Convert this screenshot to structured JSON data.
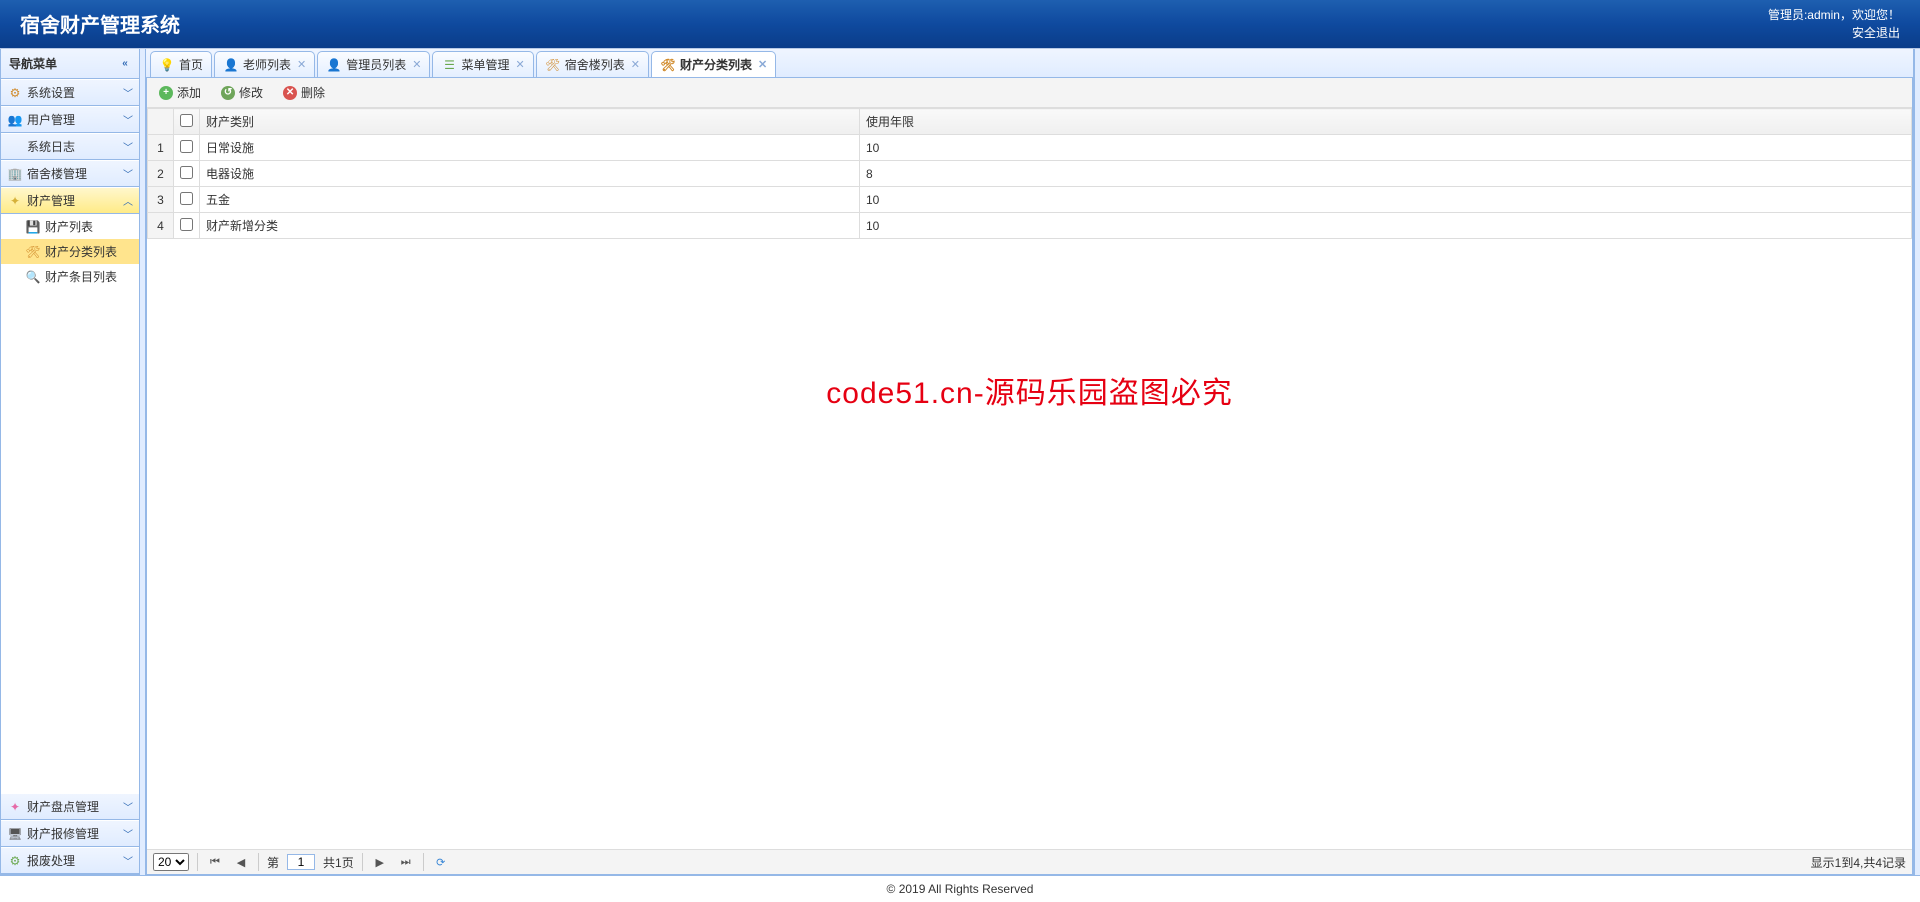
{
  "header": {
    "title": "宿舍财产管理系统",
    "admin_prefix": "管理员:",
    "admin_name": "admin",
    "welcome_suffix": "，欢迎您！",
    "logout": "安全退出"
  },
  "sidebar": {
    "title": "导航菜单",
    "panels": [
      {
        "label": "系统设置",
        "icon": "⚙",
        "color": "#d08a2a"
      },
      {
        "label": "用户管理",
        "icon": "👥",
        "color": "#3a87d6"
      },
      {
        "label": "系统日志",
        "icon": "",
        "color": "#555"
      },
      {
        "label": "宿舍楼管理",
        "icon": "🏢",
        "color": "#4a90d9"
      },
      {
        "label": "财产管理",
        "icon": "✦",
        "color": "#d6b13a",
        "active": true,
        "children": [
          {
            "label": "财产列表",
            "icon": "💾",
            "color": "#5a9bd4"
          },
          {
            "label": "财产分类列表",
            "icon": "🛠",
            "color": "#d08a2a",
            "active": true
          },
          {
            "label": "财产条目列表",
            "icon": "🔍",
            "color": "#5a9bd4"
          }
        ]
      },
      {
        "label": "财产盘点管理",
        "icon": "✦",
        "color": "#e66aa8"
      },
      {
        "label": "财产报修管理",
        "icon": "🖥",
        "color": "#555"
      },
      {
        "label": "报废处理",
        "icon": "⚙",
        "color": "#6aa84f"
      }
    ]
  },
  "tabs": [
    {
      "label": "首页",
      "icon": "💡",
      "color": "#f5c518",
      "closable": false
    },
    {
      "label": "老师列表",
      "icon": "👤",
      "color": "#5a9bd4",
      "closable": true
    },
    {
      "label": "管理员列表",
      "icon": "👤",
      "color": "#7e9e4a",
      "closable": true
    },
    {
      "label": "菜单管理",
      "icon": "☰",
      "color": "#6aa84f",
      "closable": true
    },
    {
      "label": "宿舍楼列表",
      "icon": "🛠",
      "color": "#d08a2a",
      "closable": true
    },
    {
      "label": "财产分类列表",
      "icon": "🛠",
      "color": "#d08a2a",
      "closable": true,
      "active": true
    }
  ],
  "toolbar": {
    "add": "添加",
    "edit": "修改",
    "delete": "删除"
  },
  "grid": {
    "columns": [
      "财产类别",
      "使用年限"
    ],
    "rows": [
      {
        "n": "1",
        "name": "日常设施",
        "years": "10"
      },
      {
        "n": "2",
        "name": "电器设施",
        "years": "8"
      },
      {
        "n": "3",
        "name": "五金",
        "years": "10"
      },
      {
        "n": "4",
        "name": "财产新增分类",
        "years": "10"
      }
    ]
  },
  "watermark": "code51.cn-源码乐园盗图必究",
  "pager": {
    "page_size": "20",
    "page_prefix": "第",
    "page": "1",
    "total_pages_text": "共1页",
    "info": "显示1到4,共4记录"
  },
  "footer": "© 2019 All Rights Reserved"
}
